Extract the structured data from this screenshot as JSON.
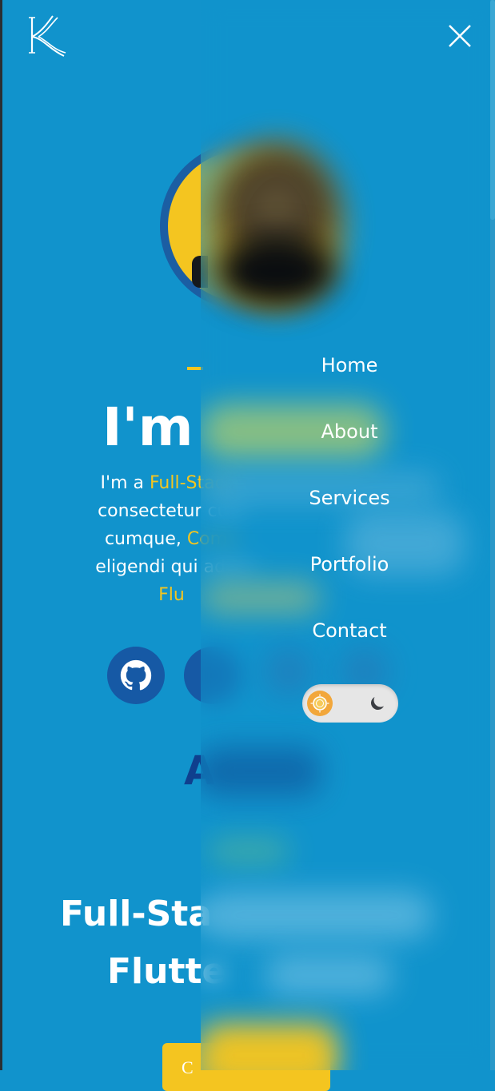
{
  "header": {
    "logo_icon": "kk-monogram-logo",
    "close_icon": "close-icon"
  },
  "hero": {
    "title_visible": "I'm",
    "intro": {
      "line1_prefix": "I'm a ",
      "line1_highlight": "Full-Stack",
      "line2": "consectetur cum",
      "line3_prefix": "cumque, ",
      "line3_highlight": "Comp",
      "line4": "eligendi qui adipis",
      "line5_highlight": "Flu"
    },
    "social": [
      "github-icon",
      "second-social-icon"
    ]
  },
  "about_section": {
    "title_visible": "A"
  },
  "headline": {
    "line1": "Full-Sta",
    "line2": "Flutte"
  },
  "cta_button": {
    "label": "C"
  },
  "menu": {
    "items": [
      {
        "label": "Home"
      },
      {
        "label": "About"
      },
      {
        "label": "Services"
      },
      {
        "label": "Portfolio"
      },
      {
        "label": "Contact"
      }
    ],
    "theme_toggle": {
      "light_icon": "sun-icon",
      "dark_icon": "moon-icon",
      "mode": "light"
    }
  },
  "colors": {
    "background": "#1193cc",
    "accent": "#f4c520",
    "social_bg": "#1659a5",
    "section_title": "#0f3f8e",
    "toggle_knob": "#f2a73b"
  }
}
